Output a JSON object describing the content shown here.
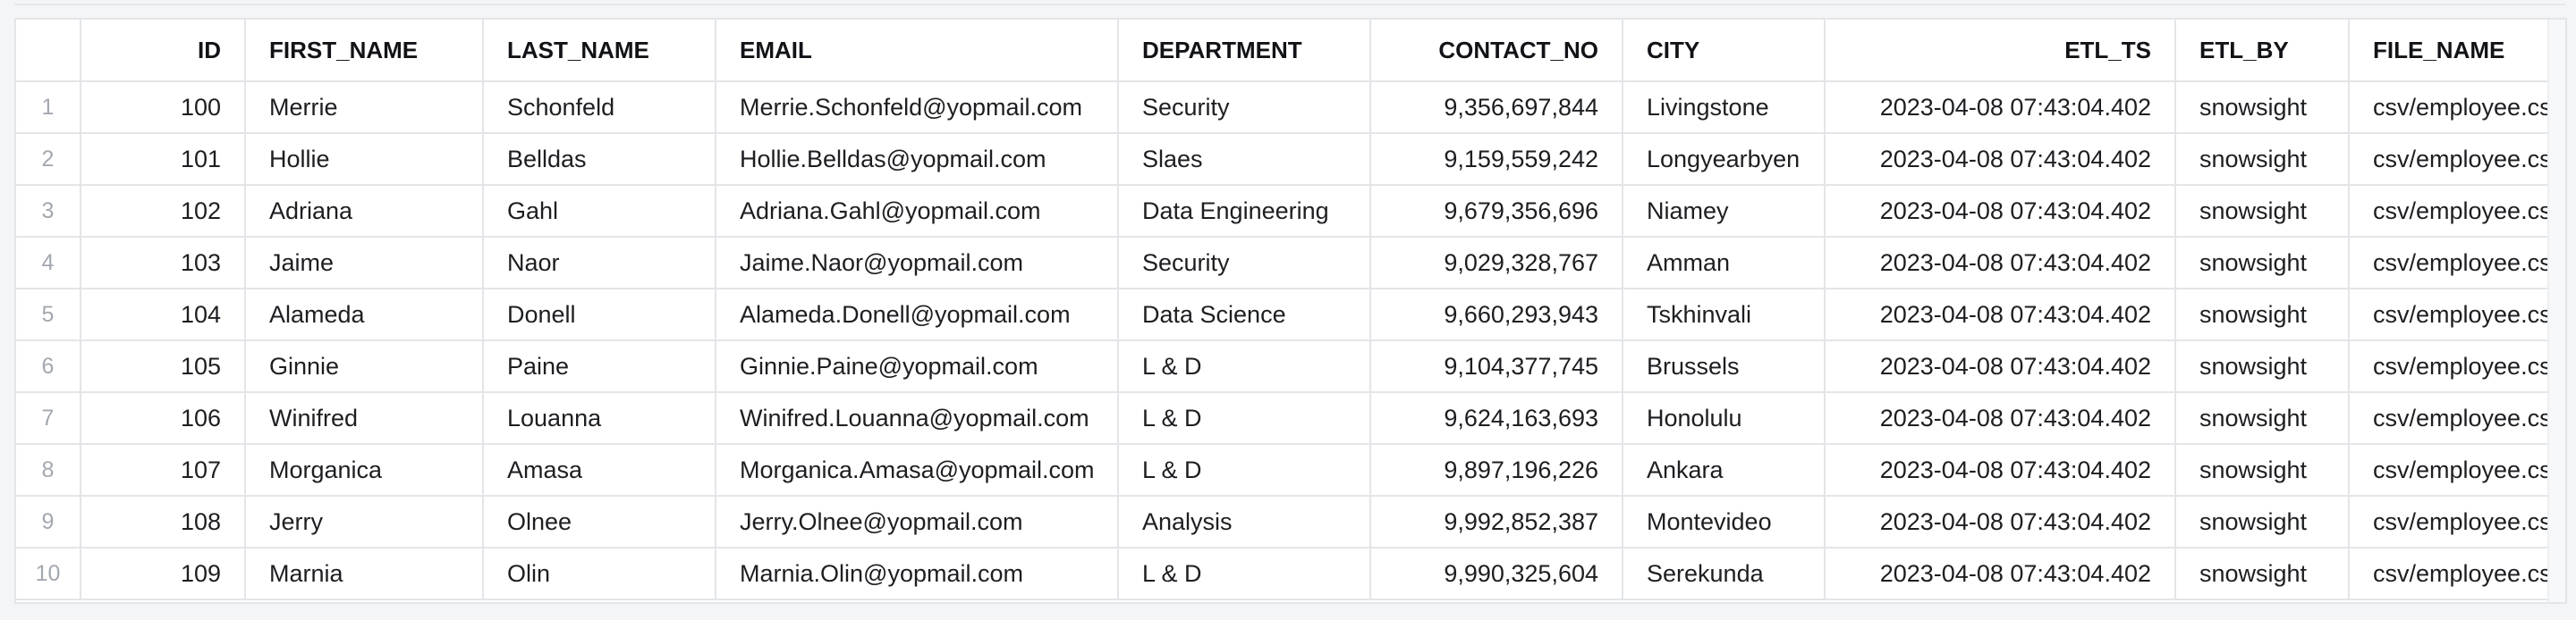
{
  "table": {
    "columns": [
      {
        "key": "id",
        "label": "ID",
        "align": "right"
      },
      {
        "key": "first_name",
        "label": "FIRST_NAME",
        "align": "left"
      },
      {
        "key": "last_name",
        "label": "LAST_NAME",
        "align": "left"
      },
      {
        "key": "email",
        "label": "EMAIL",
        "align": "left"
      },
      {
        "key": "department",
        "label": "DEPARTMENT",
        "align": "left"
      },
      {
        "key": "contact_no",
        "label": "CONTACT_NO",
        "align": "right"
      },
      {
        "key": "city",
        "label": "CITY",
        "align": "left"
      },
      {
        "key": "etl_ts",
        "label": "ETL_TS",
        "align": "right"
      },
      {
        "key": "etl_by",
        "label": "ETL_BY",
        "align": "left"
      },
      {
        "key": "file_name",
        "label": "FILE_NAME",
        "align": "left"
      }
    ],
    "rows": [
      {
        "row_num": "1",
        "id": "100",
        "first_name": "Merrie",
        "last_name": "Schonfeld",
        "email": "Merrie.Schonfeld@yopmail.com",
        "department": "Security",
        "contact_no": "9,356,697,844",
        "city": "Livingstone",
        "etl_ts": "2023-04-08 07:43:04.402",
        "etl_by": "snowsight",
        "file_name": "csv/employee.csv"
      },
      {
        "row_num": "2",
        "id": "101",
        "first_name": "Hollie",
        "last_name": "Belldas",
        "email": "Hollie.Belldas@yopmail.com",
        "department": "Slaes",
        "contact_no": "9,159,559,242",
        "city": "Longyearbyen",
        "etl_ts": "2023-04-08 07:43:04.402",
        "etl_by": "snowsight",
        "file_name": "csv/employee.csv"
      },
      {
        "row_num": "3",
        "id": "102",
        "first_name": "Adriana",
        "last_name": "Gahl",
        "email": "Adriana.Gahl@yopmail.com",
        "department": "Data Engineering",
        "contact_no": "9,679,356,696",
        "city": "Niamey",
        "etl_ts": "2023-04-08 07:43:04.402",
        "etl_by": "snowsight",
        "file_name": "csv/employee.csv"
      },
      {
        "row_num": "4",
        "id": "103",
        "first_name": "Jaime",
        "last_name": "Naor",
        "email": "Jaime.Naor@yopmail.com",
        "department": "Security",
        "contact_no": "9,029,328,767",
        "city": "Amman",
        "etl_ts": "2023-04-08 07:43:04.402",
        "etl_by": "snowsight",
        "file_name": "csv/employee.csv"
      },
      {
        "row_num": "5",
        "id": "104",
        "first_name": "Alameda",
        "last_name": "Donell",
        "email": "Alameda.Donell@yopmail.com",
        "department": "Data Science",
        "contact_no": "9,660,293,943",
        "city": "Tskhinvali",
        "etl_ts": "2023-04-08 07:43:04.402",
        "etl_by": "snowsight",
        "file_name": "csv/employee.csv"
      },
      {
        "row_num": "6",
        "id": "105",
        "first_name": "Ginnie",
        "last_name": "Paine",
        "email": "Ginnie.Paine@yopmail.com",
        "department": "L & D",
        "contact_no": "9,104,377,745",
        "city": "Brussels",
        "etl_ts": "2023-04-08 07:43:04.402",
        "etl_by": "snowsight",
        "file_name": "csv/employee.csv"
      },
      {
        "row_num": "7",
        "id": "106",
        "first_name": "Winifred",
        "last_name": "Louanna",
        "email": "Winifred.Louanna@yopmail.com",
        "department": "L & D",
        "contact_no": "9,624,163,693",
        "city": "Honolulu",
        "etl_ts": "2023-04-08 07:43:04.402",
        "etl_by": "snowsight",
        "file_name": "csv/employee.csv"
      },
      {
        "row_num": "8",
        "id": "107",
        "first_name": "Morganica",
        "last_name": "Amasa",
        "email": "Morganica.Amasa@yopmail.com",
        "department": "L & D",
        "contact_no": "9,897,196,226",
        "city": "Ankara",
        "etl_ts": "2023-04-08 07:43:04.402",
        "etl_by": "snowsight",
        "file_name": "csv/employee.csv"
      },
      {
        "row_num": "9",
        "id": "108",
        "first_name": "Jerry",
        "last_name": "Olnee",
        "email": "Jerry.Olnee@yopmail.com",
        "department": "Analysis",
        "contact_no": "9,992,852,387",
        "city": "Montevideo",
        "etl_ts": "2023-04-08 07:43:04.402",
        "etl_by": "snowsight",
        "file_name": "csv/employee.csv"
      },
      {
        "row_num": "10",
        "id": "109",
        "first_name": "Marnia",
        "last_name": "Olin",
        "email": "Marnia.Olin@yopmail.com",
        "department": "L & D",
        "contact_no": "9,990,325,604",
        "city": "Serekunda",
        "etl_ts": "2023-04-08 07:43:04.402",
        "etl_by": "snowsight",
        "file_name": "csv/employee.csv"
      }
    ]
  }
}
